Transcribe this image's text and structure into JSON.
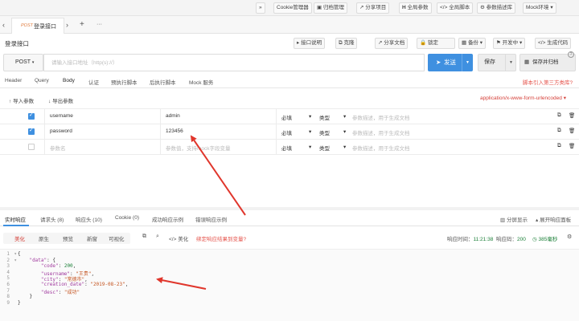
{
  "toolbar": {
    "expand_icon": "double-chevron-right-icon",
    "buttons": [
      "Cookie管理器",
      "归档管理",
      "分享项目",
      "全局参数",
      "全局脚本",
      "参数描述库",
      "Mock环境"
    ]
  },
  "tabs": {
    "items": [
      {
        "method": "POST",
        "title": "登录接口"
      }
    ],
    "add_label": "+",
    "more_label": "···"
  },
  "api": {
    "title": "登录接口",
    "buttons": [
      "接口说明",
      "克隆",
      "分享文档",
      "锁定",
      "备份",
      "开发中",
      "生成代码"
    ]
  },
  "url_bar": {
    "method": "POST",
    "placeholder": "请输入接口地址（http(s)://）",
    "send_label": "发送",
    "save_label": "保存",
    "save_scan_label": "保存并归档",
    "help": "?"
  },
  "request_tabs": [
    "Header",
    "Query",
    "Body",
    "认证",
    "预执行脚本",
    "后执行脚本",
    "Mock 服务"
  ],
  "script_link": "脚本引入第三方类库?",
  "body": {
    "import_label": "导入参数",
    "export_label": "导出参数",
    "content_type": "application/x-www-form-urlencoded",
    "rows": [
      {
        "checked": true,
        "name": "username",
        "value": "admin",
        "required": "必填",
        "type": "类型",
        "desc": "参数描述，用于生成文档"
      },
      {
        "checked": true,
        "name": "password",
        "value": "123456",
        "required": "必填",
        "type": "类型",
        "desc": "参数描述，用于生成文档"
      }
    ],
    "placeholder_row": {
      "name": "参数名",
      "value": "参数值，支持mock字段变量",
      "required": "必填",
      "type": "类型",
      "desc": "参数描述，用于生成文档"
    }
  },
  "response": {
    "tabs": [
      "实时响应",
      "请求头 (8)",
      "响应头 (10)",
      "Cookie (0)",
      "成功响应示例",
      "错误响应示例"
    ],
    "split_label": "分屏显示",
    "expand_label": "展开响应面板",
    "view_tabs": [
      "美化",
      "原生",
      "预览",
      "新窗",
      "可视化"
    ],
    "beautify_label": "美化",
    "bind_link": "绑定响应结果到变量?",
    "time_label": "响应时间：",
    "time_value": "11:21:38",
    "status_label": "响应码：",
    "status_value": "200",
    "duration": "385毫秒",
    "code_lines": [
      {
        "no": "1",
        "text": "{"
      },
      {
        "no": "2",
        "text": "    \"data\": {"
      },
      {
        "no": "3",
        "text": "        \"code\": 200,"
      },
      {
        "no": "4",
        "text": "        \"username\": \"王贵\","
      },
      {
        "no": "5",
        "text": "        \"city\": \"常德市\","
      },
      {
        "no": "6",
        "text": "        \"creation_date\": \"2019-08-23\","
      },
      {
        "no": "7",
        "text": "        \"desc\": \"成功\""
      },
      {
        "no": "8",
        "text": "    }"
      },
      {
        "no": "9",
        "text": "}"
      }
    ]
  },
  "colors": {
    "accent": "#3f90e0",
    "link_red": "#e5534b",
    "annotation_red": "#e0362c",
    "checkbox": "#3f90e0"
  }
}
